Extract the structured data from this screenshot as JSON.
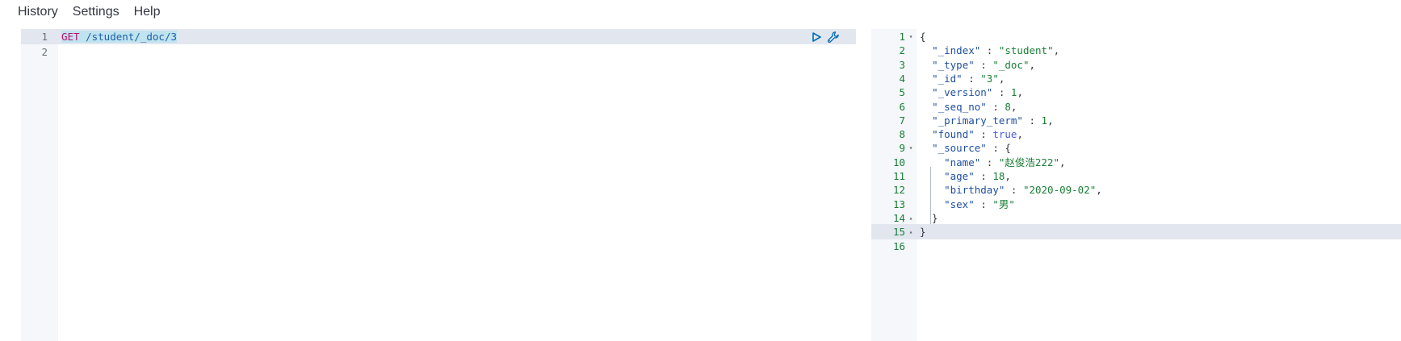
{
  "menu": [
    {
      "label": "History"
    },
    {
      "label": "Settings"
    },
    {
      "label": "Help"
    }
  ],
  "request": {
    "line_numbers": [
      "1",
      "2"
    ],
    "method": "GET",
    "path": "/student/_doc/3",
    "actions": {
      "run_icon": "play-icon",
      "settings_icon": "wrench-icon"
    }
  },
  "response": {
    "line_numbers": [
      "1",
      "2",
      "3",
      "4",
      "5",
      "6",
      "7",
      "8",
      "9",
      "10",
      "11",
      "12",
      "13",
      "14",
      "15",
      "16"
    ],
    "fold_markers": [
      "▾",
      "",
      "",
      "",
      "",
      "",
      "",
      "",
      "▾",
      "",
      "",
      "",
      "",
      "▴",
      "▴",
      ""
    ],
    "lines": [
      [
        {
          "t": "punc",
          "v": "{"
        }
      ],
      [
        {
          "t": "punc",
          "v": "  "
        },
        {
          "t": "key",
          "v": "\"_index\""
        },
        {
          "t": "punc",
          "v": " : "
        },
        {
          "t": "str",
          "v": "\"student\""
        },
        {
          "t": "punc",
          "v": ","
        }
      ],
      [
        {
          "t": "punc",
          "v": "  "
        },
        {
          "t": "key",
          "v": "\"_type\""
        },
        {
          "t": "punc",
          "v": " : "
        },
        {
          "t": "str",
          "v": "\"_doc\""
        },
        {
          "t": "punc",
          "v": ","
        }
      ],
      [
        {
          "t": "punc",
          "v": "  "
        },
        {
          "t": "key",
          "v": "\"_id\""
        },
        {
          "t": "punc",
          "v": " : "
        },
        {
          "t": "str",
          "v": "\"3\""
        },
        {
          "t": "punc",
          "v": ","
        }
      ],
      [
        {
          "t": "punc",
          "v": "  "
        },
        {
          "t": "key",
          "v": "\"_version\""
        },
        {
          "t": "punc",
          "v": " : "
        },
        {
          "t": "num",
          "v": "1"
        },
        {
          "t": "punc",
          "v": ","
        }
      ],
      [
        {
          "t": "punc",
          "v": "  "
        },
        {
          "t": "key",
          "v": "\"_seq_no\""
        },
        {
          "t": "punc",
          "v": " : "
        },
        {
          "t": "num",
          "v": "8"
        },
        {
          "t": "punc",
          "v": ","
        }
      ],
      [
        {
          "t": "punc",
          "v": "  "
        },
        {
          "t": "key",
          "v": "\"_primary_term\""
        },
        {
          "t": "punc",
          "v": " : "
        },
        {
          "t": "num",
          "v": "1"
        },
        {
          "t": "punc",
          "v": ","
        }
      ],
      [
        {
          "t": "punc",
          "v": "  "
        },
        {
          "t": "key",
          "v": "\"found\""
        },
        {
          "t": "punc",
          "v": " : "
        },
        {
          "t": "bool",
          "v": "true"
        },
        {
          "t": "punc",
          "v": ","
        }
      ],
      [
        {
          "t": "punc",
          "v": "  "
        },
        {
          "t": "key",
          "v": "\"_source\""
        },
        {
          "t": "punc",
          "v": " : {"
        }
      ],
      [
        {
          "t": "punc",
          "v": "    "
        },
        {
          "t": "key",
          "v": "\"name\""
        },
        {
          "t": "punc",
          "v": " : "
        },
        {
          "t": "str",
          "v": "\"赵俊浩222\""
        },
        {
          "t": "punc",
          "v": ","
        }
      ],
      [
        {
          "t": "punc",
          "v": "    "
        },
        {
          "t": "key",
          "v": "\"age\""
        },
        {
          "t": "punc",
          "v": " : "
        },
        {
          "t": "num",
          "v": "18"
        },
        {
          "t": "punc",
          "v": ","
        }
      ],
      [
        {
          "t": "punc",
          "v": "    "
        },
        {
          "t": "key",
          "v": "\"birthday\""
        },
        {
          "t": "punc",
          "v": " : "
        },
        {
          "t": "str",
          "v": "\"2020-09-02\""
        },
        {
          "t": "punc",
          "v": ","
        }
      ],
      [
        {
          "t": "punc",
          "v": "    "
        },
        {
          "t": "key",
          "v": "\"sex\""
        },
        {
          "t": "punc",
          "v": " : "
        },
        {
          "t": "str",
          "v": "\"男\""
        }
      ],
      [
        {
          "t": "punc",
          "v": "  }"
        }
      ],
      [
        {
          "t": "punc",
          "v": "}"
        }
      ],
      [
        {
          "t": "punc",
          "v": ""
        }
      ]
    ]
  },
  "colors": {
    "gutter": "#f5f7fa",
    "active_line": "#e2e7ef",
    "selection": "#bfe3ef",
    "method": "#bf0f66",
    "path": "#1f5fa8",
    "key": "#1e4f9e",
    "string": "#1a7f36",
    "boolean": "#4a5ae0"
  }
}
